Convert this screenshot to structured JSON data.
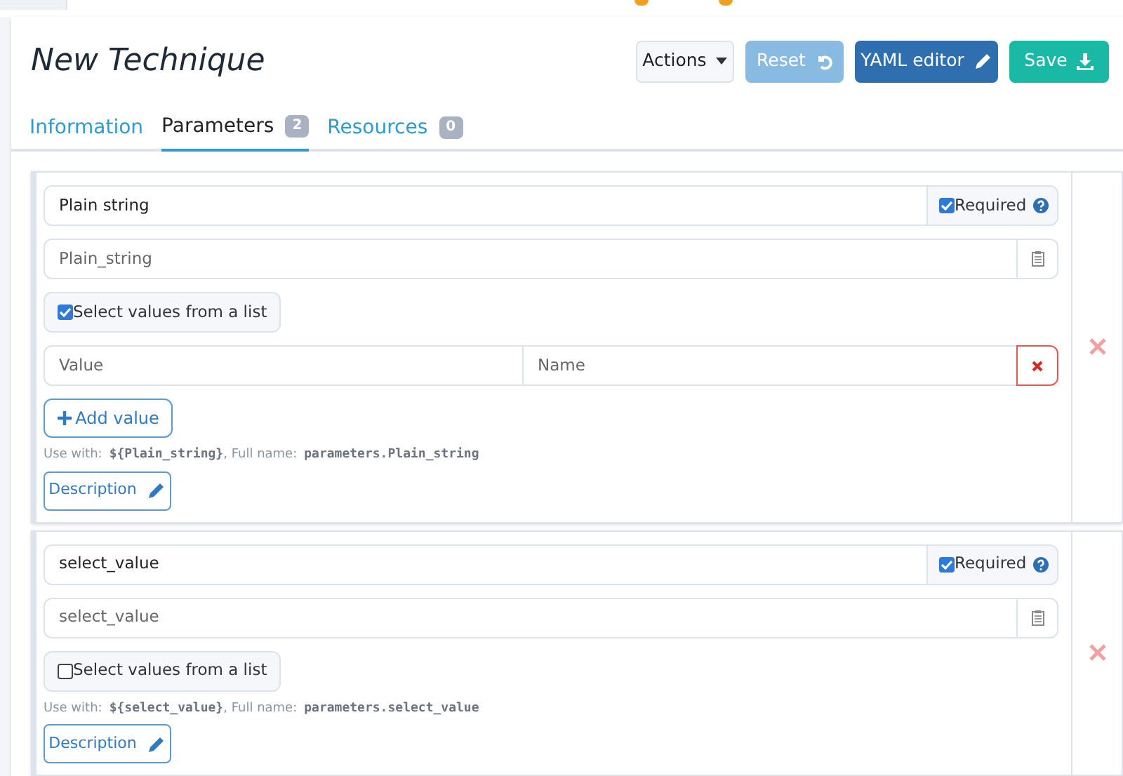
{
  "title": "New Technique",
  "actions": [
    {
      "label": "Actions",
      "kind": "dropdown"
    },
    {
      "label": "Reset",
      "kind": "reset",
      "disabled": true
    },
    {
      "label": "YAML editor",
      "kind": "yaml"
    },
    {
      "label": "Save",
      "kind": "save"
    }
  ],
  "tabs": [
    {
      "label": "Information",
      "selected": false
    },
    {
      "label": "Parameters",
      "selected": true,
      "badge": "2"
    },
    {
      "label": "Resources",
      "selected": false,
      "badge": "0"
    }
  ],
  "parameters": [
    {
      "name": "Plain string",
      "required_label": "Required",
      "required": true,
      "variable_placeholder": "Plain_string",
      "list_label": "Select values from a list",
      "select_from_list": true,
      "values": [
        {
          "value_placeholder": "Value",
          "name_placeholder": "Name"
        }
      ],
      "add_value": "Add value",
      "use_with_label": "Use with:",
      "use_with_code": "${Plain_string}",
      "full_name_label": ", Full name:",
      "full_name_code": "parameters.Plain_string",
      "description": "Description"
    },
    {
      "name": "select_value",
      "required_label": "Required",
      "required": true,
      "variable_placeholder": "select_value",
      "list_label": "Select values from a list",
      "select_from_list": false,
      "use_with_label": "Use with:",
      "use_with_code": "${select_value}",
      "full_name_label": ", Full name:",
      "full_name_code": "parameters.select_value",
      "description": "Description"
    }
  ]
}
